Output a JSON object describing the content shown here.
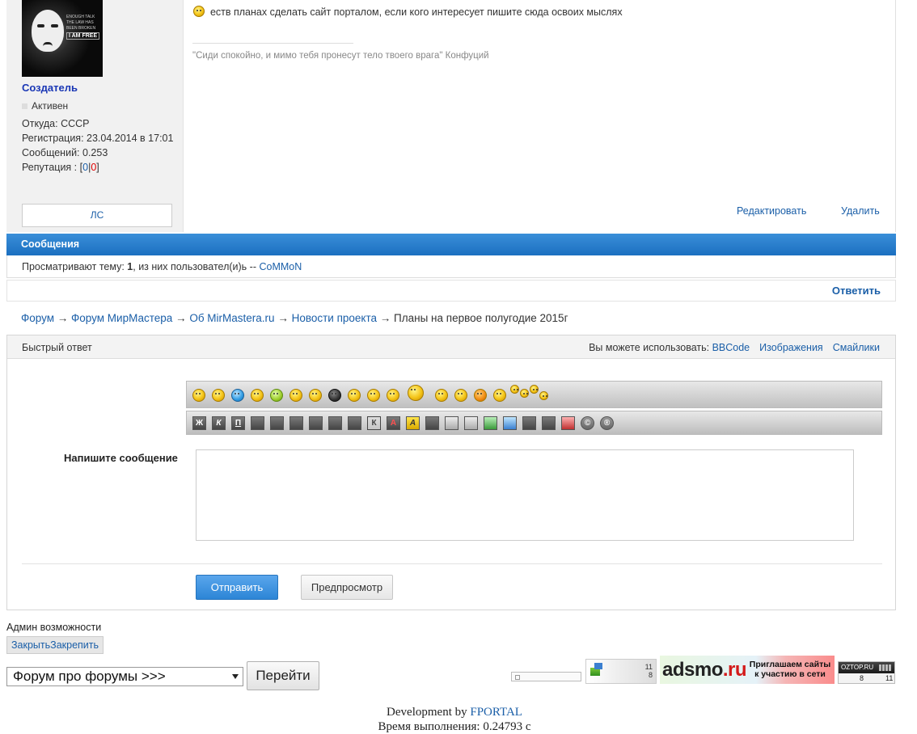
{
  "post": {
    "author": {
      "avatar_text": "ENOUGH TALK THE LAW HAS BEEN BROKEN",
      "avatar_badge": "I AM FREE",
      "name": "Создатель",
      "status": "Активен",
      "from": "Откуда: СССР",
      "registered": "Регистрация: 23.04.2014 в 17:01",
      "messages": "Сообщений: 0.253",
      "reputation_label": "Репутация : [",
      "reputation_plus": "0",
      "reputation_sep": "|",
      "reputation_minus": "0",
      "reputation_end": "]",
      "pm_button": "ЛС"
    },
    "text": "еств планах сделать сайт порталом, если кого интересует пишите сюда освоих мыслях",
    "signature": "\"Сиди спокойно, и мимо тебя пронесут тело твоего врага\"  Конфуций",
    "edit_label": "Редактировать",
    "delete_label": "Удалить"
  },
  "messages_bar": {
    "title": "Сообщения"
  },
  "viewing": {
    "prefix": "Просматривают тему: ",
    "count": "1",
    "middle": ", из них пользовател(и)ь -- ",
    "user": "CoMMoN"
  },
  "reply_label": "Ответить",
  "breadcrumb": {
    "items": [
      "Форум",
      "Форум МирМастера",
      "Об MirMastera.ru",
      "Новости проекта"
    ],
    "separator": " → ",
    "current": "Планы на первое полугодие 2015г"
  },
  "quick_reply": {
    "title": "Быстрый ответ",
    "can_use_label": "Вы можете использовать:",
    "options": [
      "BBCode",
      "Изображения",
      "Смайлики"
    ],
    "write_label": "Напишите сообщение",
    "textarea_value": "",
    "send_label": "Отправить",
    "preview_label": "Предпросмотр",
    "bbcode_buttons": [
      "Ж",
      "К",
      "П",
      "",
      "",
      "",
      "",
      "",
      "",
      "К",
      "А",
      "А",
      "",
      "",
      "",
      "",
      "",
      "",
      "",
      "",
      "©",
      "®"
    ]
  },
  "admin": {
    "label": "Админ возможности",
    "close_label": "Закрыть",
    "pin_label": "Закрепить"
  },
  "forum_select": {
    "selected": "Форум про форумы >>>",
    "go_label": "Перейти"
  },
  "counters": {
    "counter2_top": "11",
    "counter2_bottom": "8",
    "adsmo_logo_a": "adsmo",
    "adsmo_logo_b": ".ru",
    "adsmo_text": "Приглашаем сайты к участию в сети",
    "oztop_name": "OZTOP.RU",
    "oztop_n1": "8",
    "oztop_n2": "11"
  },
  "footer": {
    "dev_prefix": "Development by ",
    "dev_link": "FPORTAL",
    "exec_time": "Время выполнения: 0.24793 c"
  },
  "colors": {
    "accent": "#1b6fc0",
    "link": "#1b5fa8",
    "username": "#1a37b5",
    "reputation_minus": "#dd0000"
  }
}
